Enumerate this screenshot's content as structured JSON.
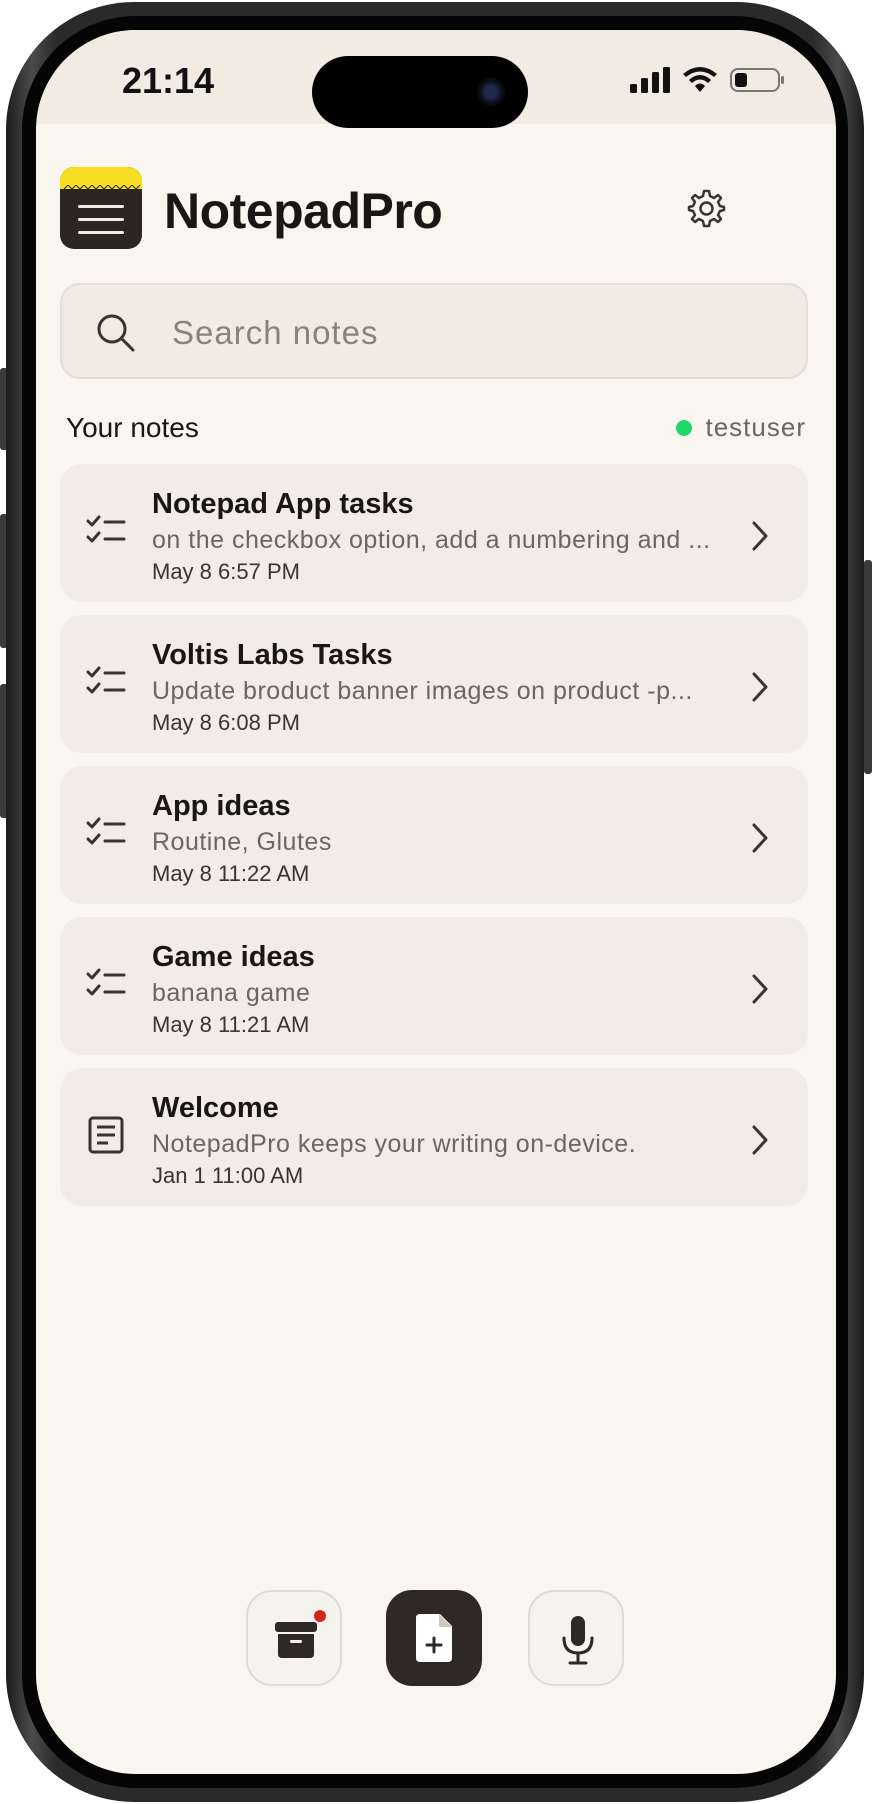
{
  "status_bar": {
    "time": "21:14"
  },
  "header": {
    "app_name": "NotepadPro"
  },
  "search": {
    "placeholder": "Search notes",
    "value": ""
  },
  "section": {
    "title": "Your notes",
    "user": "testuser",
    "user_status_color": "#22d66e"
  },
  "notes": [
    {
      "icon": "checklist-icon",
      "title": "Notepad App tasks",
      "preview": "on the checkbox option, add a numbering and ...",
      "date": "May 8 6:57 PM"
    },
    {
      "icon": "checklist-icon",
      "title": "Voltis Labs Tasks",
      "preview": "Update broduct banner images on product -p...",
      "date": "May 8 6:08 PM"
    },
    {
      "icon": "checklist-icon",
      "title": "App ideas",
      "preview": "Routine, Glutes",
      "date": "May 8 11:22 AM"
    },
    {
      "icon": "checklist-icon",
      "title": "Game ideas",
      "preview": "banana game",
      "date": "May 8 11:21 AM"
    },
    {
      "icon": "document-icon",
      "title": "Welcome",
      "preview": "NotepadPro keeps your writing on-device.",
      "date": "Jan 1 11:00 AM"
    }
  ],
  "bottom_bar": {
    "archive": {
      "icon": "archive-box-icon",
      "has_badge": true
    },
    "new_note": {
      "icon": "new-document-icon"
    },
    "voice": {
      "icon": "microphone-icon"
    }
  },
  "colors": {
    "accent_yellow": "#f8de22",
    "dark": "#2e2826",
    "background": "#f9f6f0",
    "badge": "#d12626"
  }
}
